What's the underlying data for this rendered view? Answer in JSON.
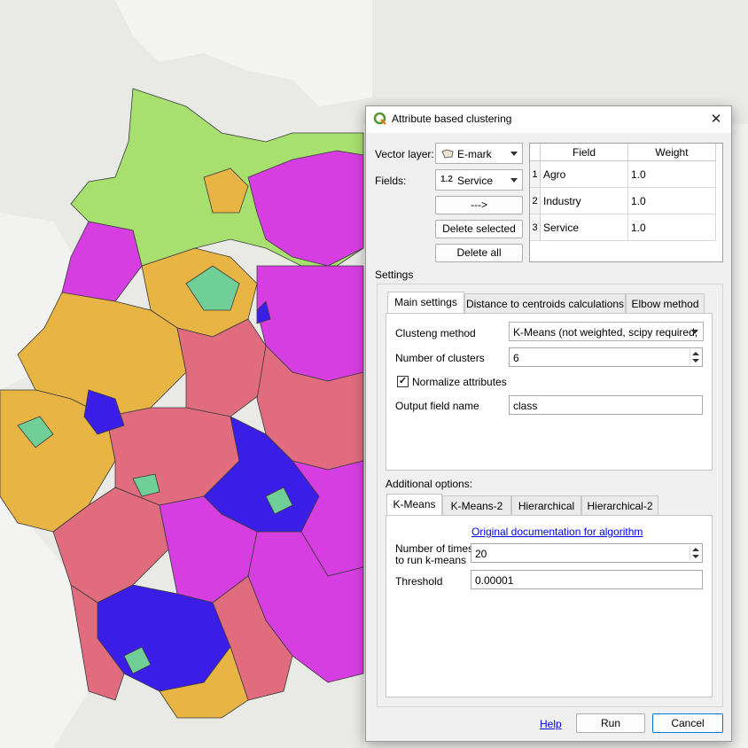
{
  "dialog": {
    "title": "Attribute based clustering",
    "close_glyph": "✕",
    "vector_layer_label": "Vector layer:",
    "vector_layer_value": "E-mark",
    "fields_label": "Fields:",
    "fields_type_badge": "1.2",
    "fields_value": "Service",
    "add_button": "--->",
    "delete_selected_button": "Delete selected",
    "delete_all_button": "Delete all",
    "table": {
      "headers": [
        "Field",
        "Weight"
      ],
      "rows": [
        {
          "num": "1",
          "field": "Agro",
          "weight": "1.0"
        },
        {
          "num": "2",
          "field": "Industry",
          "weight": "1.0"
        },
        {
          "num": "3",
          "field": "Service",
          "weight": "1.0"
        }
      ]
    },
    "settings_label": "Settings",
    "settings_tabs": [
      "Main settings",
      "Distance to centroids calculations",
      "Elbow method"
    ],
    "main": {
      "method_label": "Clusteng method",
      "method_value": "K-Means (not weighted, scipy required,",
      "clusters_label": "Number of clusters",
      "clusters_value": "6",
      "normalize_label": "Normalize attributes",
      "normalize_checked": true,
      "check_glyph": "✓",
      "output_label": "Output field name",
      "output_value": "class"
    },
    "additional_label": "Additional options:",
    "algo_tabs": [
      "K-Means",
      "K-Means-2",
      "Hierarchical",
      "Hierarchical-2"
    ],
    "kmeans": {
      "doc_link": "Original documentation for algorithm",
      "times_label_1": "Number of times",
      "times_label_2": "to run k-means",
      "times_value": "20",
      "threshold_label": "Threshold",
      "threshold_value": "0.00001"
    },
    "footer": {
      "help": "Help",
      "run": "Run",
      "cancel": "Cancel"
    }
  },
  "colors": {
    "map_water": "#e9e9e6",
    "cluster_green": "#a8e070",
    "cluster_magenta": "#d63ee2",
    "cluster_orange": "#e8b444",
    "cluster_pink": "#e06c7e",
    "cluster_teal": "#6fcf97",
    "cluster_blue": "#3a1ee8",
    "qgis_green": "#589632"
  }
}
